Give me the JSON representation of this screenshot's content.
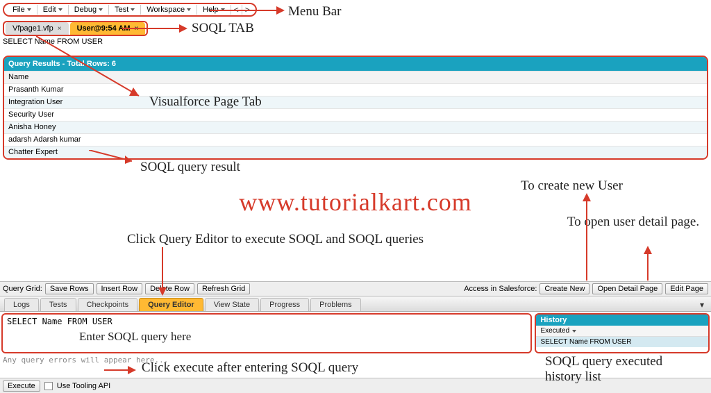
{
  "menubar": {
    "items": [
      "File",
      "Edit",
      "Debug",
      "Test",
      "Workspace",
      "Help"
    ],
    "prev": "<",
    "next": ">"
  },
  "tabs": {
    "vf_label": "Vfpage1.vfp",
    "soql_label": "User@9:54 AM"
  },
  "soql_line": "SELECT Name FROM USER",
  "results": {
    "title": "Query Results - Total Rows: 6",
    "column": "Name",
    "rows": [
      "Prasanth Kumar",
      "Integration User",
      "Security User",
      "Anisha Honey",
      "adarsh Adarsh kumar",
      "Chatter Expert"
    ]
  },
  "watermark": "www.tutorialkart.com",
  "gridbar": {
    "label": "Query Grid:",
    "save": "Save Rows",
    "insert": "Insert Row",
    "delete": "Delete Row",
    "refresh": "Refresh Grid",
    "access": "Access in Salesforce:",
    "create": "Create New",
    "open": "Open Detail Page",
    "edit": "Edit Page"
  },
  "paneltabs": {
    "items": [
      "Logs",
      "Tests",
      "Checkpoints",
      "Query Editor",
      "View State",
      "Progress",
      "Problems"
    ],
    "active": 3
  },
  "editor": {
    "text": "SELECT Name FROM USER"
  },
  "history": {
    "title": "History",
    "filter": "Executed",
    "item": "SELECT Name FROM USER"
  },
  "errline": "Any query errors will appear here...",
  "exec": {
    "btn": "Execute",
    "chk": "Use Tooling API"
  },
  "anno": {
    "menubar": "Menu Bar",
    "soql_tab": "SOQL TAB",
    "vf_tab": "Visualforce Page Tab",
    "results": "SOQL query result",
    "qe": "Click Query Editor to execute SOQL and SOQL queries",
    "enter": "Enter SOQL query here",
    "exec": "Click execute after entering SOQL query",
    "new_user": "To create new User",
    "open_user": "To open user detail page.",
    "hist": "SOQL query executed history list"
  }
}
